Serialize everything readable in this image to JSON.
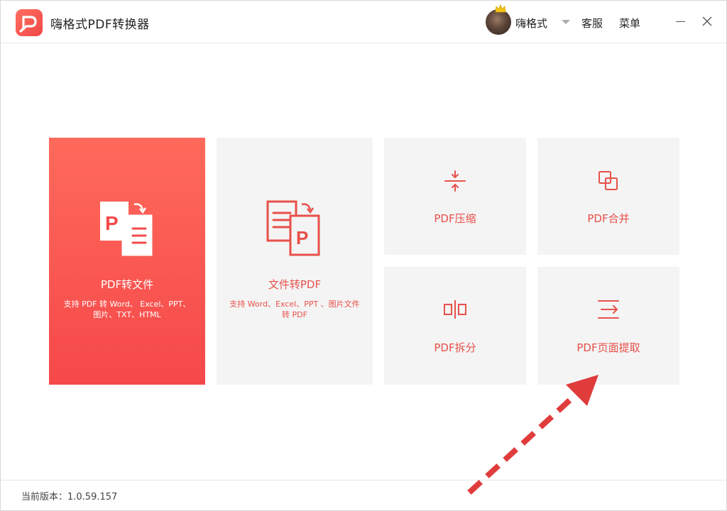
{
  "app": {
    "title": "嗨格式PDF转换器",
    "brand_color": "#f04848"
  },
  "header": {
    "username": "嗨格式",
    "service_label": "客服",
    "menu_label": "菜单"
  },
  "tiles": {
    "pdf_to_file": {
      "label": "PDF转文件",
      "description": "支持 PDF 转 Word、 Excel、PPT、图片、TXT、HTML",
      "icon": "pdf-to-file-icon"
    },
    "file_to_pdf": {
      "label": "文件转PDF",
      "description": "支持 Word、Excel、PPT 、图片文件转 PDF",
      "icon": "file-to-pdf-icon"
    },
    "compress": {
      "label": "PDF压缩",
      "icon": "compress-icon"
    },
    "merge": {
      "label": "PDF合并",
      "icon": "merge-icon"
    },
    "split": {
      "label": "PDF拆分",
      "icon": "split-icon"
    },
    "extract": {
      "label": "PDF页面提取",
      "icon": "extract-icon"
    }
  },
  "footer": {
    "version": "当前版本：1.0.59.157"
  },
  "annotation": {
    "arrow_color": "#e03c3c"
  }
}
